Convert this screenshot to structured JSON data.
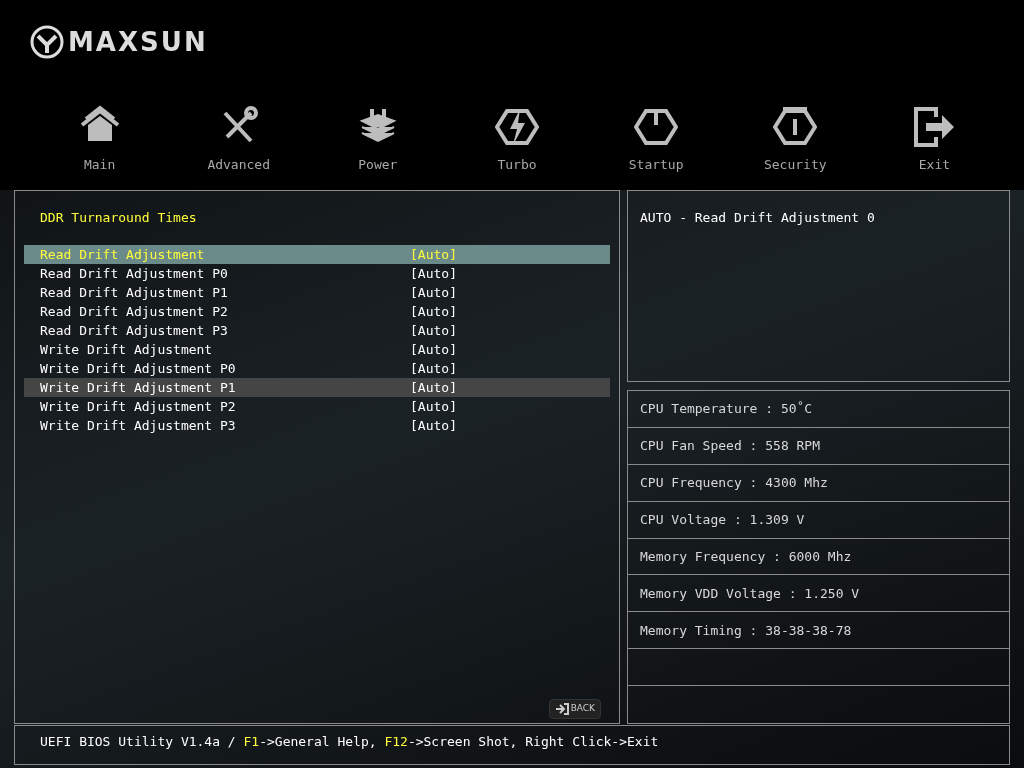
{
  "logo": {
    "text": "MAXSUN"
  },
  "tabs": [
    {
      "label": "Main",
      "kind": "home"
    },
    {
      "label": "Advanced",
      "kind": "tools"
    },
    {
      "label": "Power",
      "kind": "power"
    },
    {
      "label": "Turbo",
      "kind": "turbo"
    },
    {
      "label": "Startup",
      "kind": "startup"
    },
    {
      "label": "Security",
      "kind": "security"
    },
    {
      "label": "Exit",
      "kind": "exit"
    }
  ],
  "settings": {
    "title": "DDR Turnaround Times",
    "items": [
      {
        "label": "Read Drift Adjustment",
        "value": "[Auto]",
        "selected": true,
        "hovered": false
      },
      {
        "label": "Read Drift Adjustment P0",
        "value": "[Auto]",
        "selected": false,
        "hovered": false
      },
      {
        "label": "Read Drift Adjustment P1",
        "value": "[Auto]",
        "selected": false,
        "hovered": false
      },
      {
        "label": "Read Drift Adjustment P2",
        "value": "[Auto]",
        "selected": false,
        "hovered": false
      },
      {
        "label": "Read Drift Adjustment P3",
        "value": "[Auto]",
        "selected": false,
        "hovered": false
      },
      {
        "label": "Write Drift Adjustment",
        "value": "[Auto]",
        "selected": false,
        "hovered": false
      },
      {
        "label": "Write Drift Adjustment P0",
        "value": "[Auto]",
        "selected": false,
        "hovered": false
      },
      {
        "label": "Write Drift Adjustment P1",
        "value": "[Auto]",
        "selected": false,
        "hovered": true
      },
      {
        "label": "Write Drift Adjustment P2",
        "value": "[Auto]",
        "selected": false,
        "hovered": false
      },
      {
        "label": "Write Drift Adjustment P3",
        "value": "[Auto]",
        "selected": false,
        "hovered": false
      }
    ],
    "back_button": "BACK"
  },
  "help": {
    "text": "AUTO - Read Drift Adjustment 0"
  },
  "monitor": [
    "CPU Temperature : 50˚C",
    "CPU Fan Speed : 558 RPM",
    "CPU Frequency : 4300 Mhz",
    "CPU Voltage : 1.309 V",
    "Memory Frequency : 6000 Mhz",
    "Memory VDD Voltage : 1.250 V",
    "Memory Timing : 38-38-38-78"
  ],
  "status_bar": [
    {
      "text": "UEFI BIOS Utility V1.4a / ",
      "kind": "text"
    },
    {
      "text": "F1",
      "kind": "key"
    },
    {
      "text": "->General Help, ",
      "kind": "text"
    },
    {
      "text": "F12",
      "kind": "key"
    },
    {
      "text": "->Screen Shot, Right Click->Exit",
      "kind": "text"
    }
  ]
}
